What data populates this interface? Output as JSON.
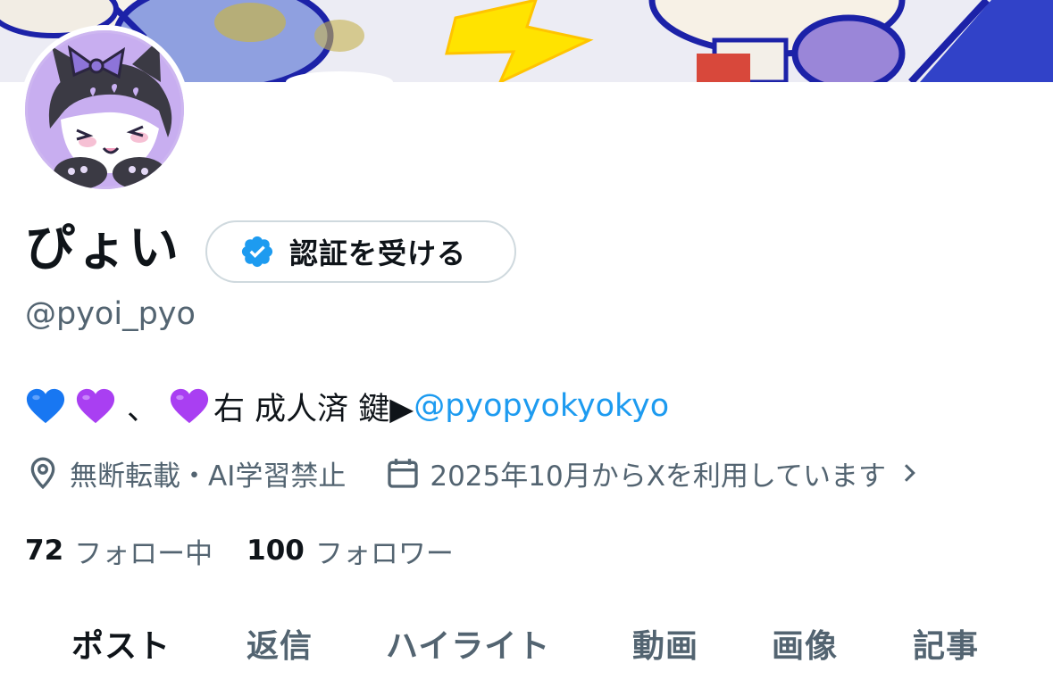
{
  "profile": {
    "display_name": "ぴょい",
    "handle": "@pyoi_pyo",
    "verify_button_label": "認証を受ける",
    "bio": {
      "hearts": [
        "blue-heart",
        "purple-heart",
        "purple-heart"
      ],
      "comma": "、",
      "text": "右 成人済 鍵▶",
      "mention": "@pyopyokyokyo"
    },
    "location": "無断転載・AI学習禁止",
    "joined": "2025年10月からXを利用しています",
    "following_count": "72",
    "following_label": "フォロー中",
    "followers_count": "100",
    "followers_label": "フォロワー"
  },
  "tabs": [
    {
      "label": "ポスト",
      "active": true
    },
    {
      "label": "返信",
      "active": false
    },
    {
      "label": "ハイライト",
      "active": false
    },
    {
      "label": "動画",
      "active": false
    },
    {
      "label": "画像",
      "active": false
    },
    {
      "label": "記事",
      "active": false
    }
  ],
  "icons": {
    "verify": "verified-badge-icon",
    "location": "location-pin-icon",
    "calendar": "calendar-icon",
    "chevron": "chevron-right-icon"
  },
  "colors": {
    "link": "#1d9bf0",
    "secondary_text": "#536471",
    "primary_text": "#0f1419",
    "blue_heart": "#1877f2",
    "purple_heart": "#a93ff2",
    "border": "#cfd9de"
  }
}
